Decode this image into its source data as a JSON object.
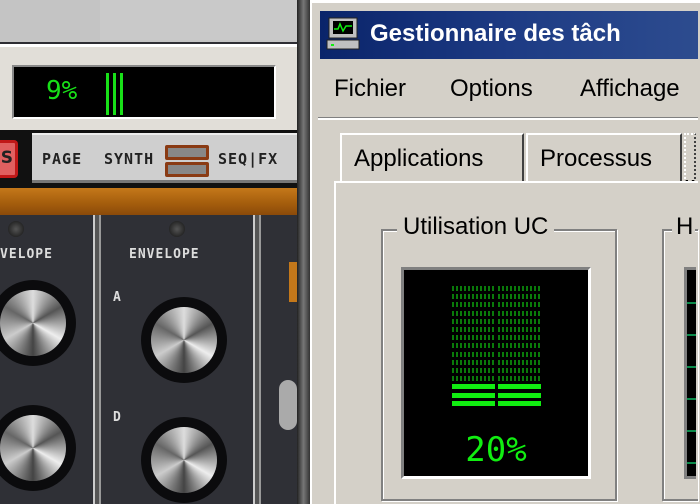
{
  "synth": {
    "cpu_readout": "9%",
    "red_button_label": "S",
    "page_label": "PAGE",
    "synth_label": "SYNTH",
    "seqfx_label": "SEQ|FX",
    "panels": [
      {
        "title": "VELOPE",
        "knobs": []
      },
      {
        "title": "ENVELOPE",
        "knobs": [
          "A",
          "D"
        ]
      }
    ]
  },
  "taskmgr": {
    "title": "Gestionnaire des tâch",
    "menu": [
      "Fichier",
      "Options",
      "Affichage"
    ],
    "tabs": [
      "Applications",
      "Processus"
    ],
    "cpu_group_label": "Utilisation UC",
    "cpu_usage_percent": 20,
    "cpu_usage_text": "20%",
    "history_group_label": "H"
  },
  "colors": {
    "lcd_green": "#11ee11",
    "title_bar": "#0a246a"
  }
}
